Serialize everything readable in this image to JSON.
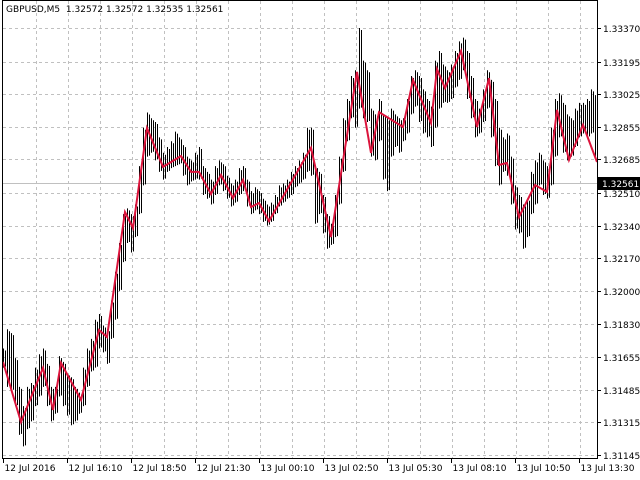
{
  "header": {
    "symbol": "GBPUSD,M5",
    "open": "1.32572",
    "high": "1.32572",
    "low": "1.32535",
    "close": "1.32561"
  },
  "colors": {
    "bars": "#000000",
    "zigzag": "#dc143c",
    "grid": "#c0c0c0",
    "price_line": "#c0c0c0",
    "price_label_bg": "#000000",
    "price_label_text": "#ffffff"
  },
  "chart_data": {
    "type": "bar",
    "title": "GBPUSD,M5",
    "current_price": "1.32561",
    "ylim": [
      1.31145,
      1.3337
    ],
    "y_ticks": [
      "1.33370",
      "1.33195",
      "1.33025",
      "1.32855",
      "1.32685",
      "1.32510",
      "1.32340",
      "1.32170",
      "1.32000",
      "1.31830",
      "1.31655",
      "1.31485",
      "1.31315",
      "1.31145"
    ],
    "x_ticks": [
      {
        "bar": 0,
        "label": "12 Jul 2016"
      },
      {
        "bar": 32,
        "label": "12 Jul 16:10"
      },
      {
        "bar": 64,
        "label": "12 Jul 18:50"
      },
      {
        "bar": 96,
        "label": "12 Jul 21:30"
      },
      {
        "bar": 128,
        "label": "13 Jul 00:10"
      },
      {
        "bar": 160,
        "label": "13 Jul 02:50"
      },
      {
        "bar": 192,
        "label": "13 Jul 05:30"
      },
      {
        "bar": 224,
        "label": "13 Jul 08:10"
      },
      {
        "bar": 256,
        "label": "13 Jul 10:50"
      },
      {
        "bar": 288,
        "label": "13 Jul 13:30"
      }
    ],
    "grid": true,
    "bars_hl": [
      [
        0,
        1.317,
        1.316
      ],
      [
        2,
        1.318,
        1.315
      ],
      [
        4,
        1.3178,
        1.3148
      ],
      [
        6,
        1.3165,
        1.314
      ],
      [
        8,
        1.315,
        1.3125
      ],
      [
        10,
        1.314,
        1.3119
      ],
      [
        12,
        1.315,
        1.3128
      ],
      [
        14,
        1.3152,
        1.3132
      ],
      [
        16,
        1.316,
        1.314
      ],
      [
        18,
        1.3167,
        1.3145
      ],
      [
        20,
        1.317,
        1.315
      ],
      [
        22,
        1.3162,
        1.314
      ],
      [
        24,
        1.315,
        1.3132
      ],
      [
        26,
        1.315,
        1.3136
      ],
      [
        28,
        1.3166,
        1.3145
      ],
      [
        30,
        1.3163,
        1.314
      ],
      [
        32,
        1.3157,
        1.3135
      ],
      [
        34,
        1.3155,
        1.313
      ],
      [
        36,
        1.315,
        1.3132
      ],
      [
        38,
        1.3147,
        1.3136
      ],
      [
        40,
        1.316,
        1.314
      ],
      [
        42,
        1.317,
        1.315
      ],
      [
        44,
        1.3175,
        1.3158
      ],
      [
        46,
        1.3185,
        1.316
      ],
      [
        48,
        1.3188,
        1.317
      ],
      [
        50,
        1.3182,
        1.3168
      ],
      [
        52,
        1.318,
        1.3162
      ],
      [
        54,
        1.3195,
        1.3175
      ],
      [
        56,
        1.321,
        1.3185
      ],
      [
        58,
        1.3225,
        1.32
      ],
      [
        60,
        1.324,
        1.3215
      ],
      [
        62,
        1.3243,
        1.3225
      ],
      [
        64,
        1.324,
        1.322
      ],
      [
        66,
        1.3245,
        1.3228
      ],
      [
        68,
        1.3265,
        1.324
      ],
      [
        70,
        1.3285,
        1.3255
      ],
      [
        72,
        1.3293,
        1.327
      ],
      [
        74,
        1.329,
        1.3272
      ],
      [
        76,
        1.3288,
        1.3268
      ],
      [
        78,
        1.328,
        1.3262
      ],
      [
        80,
        1.3272,
        1.3258
      ],
      [
        82,
        1.3275,
        1.3262
      ],
      [
        84,
        1.3278,
        1.3264
      ],
      [
        86,
        1.3283,
        1.3265
      ],
      [
        88,
        1.328,
        1.3266
      ],
      [
        90,
        1.3276,
        1.326
      ],
      [
        92,
        1.327,
        1.3255
      ],
      [
        94,
        1.3268,
        1.3257
      ],
      [
        96,
        1.3272,
        1.3258
      ],
      [
        98,
        1.3275,
        1.3258
      ],
      [
        100,
        1.3265,
        1.325
      ],
      [
        102,
        1.3262,
        1.3248
      ],
      [
        104,
        1.3258,
        1.3245
      ],
      [
        106,
        1.3265,
        1.325
      ],
      [
        108,
        1.3268,
        1.3255
      ],
      [
        110,
        1.3266,
        1.3252
      ],
      [
        112,
        1.326,
        1.3248
      ],
      [
        114,
        1.3256,
        1.3244
      ],
      [
        116,
        1.3258,
        1.3246
      ],
      [
        118,
        1.3264,
        1.325
      ],
      [
        120,
        1.3265,
        1.3252
      ],
      [
        122,
        1.3258,
        1.3244
      ],
      [
        124,
        1.3252,
        1.324
      ],
      [
        126,
        1.3254,
        1.3242
      ],
      [
        128,
        1.3252,
        1.324
      ],
      [
        130,
        1.3248,
        1.3236
      ],
      [
        132,
        1.3245,
        1.3234
      ],
      [
        134,
        1.3246,
        1.3236
      ],
      [
        136,
        1.325,
        1.324
      ],
      [
        138,
        1.3255,
        1.3244
      ],
      [
        140,
        1.3256,
        1.3246
      ],
      [
        142,
        1.3258,
        1.3248
      ],
      [
        144,
        1.3262,
        1.325
      ],
      [
        146,
        1.3265,
        1.3254
      ],
      [
        148,
        1.3268,
        1.3256
      ],
      [
        150,
        1.3272,
        1.3258
      ],
      [
        152,
        1.3285,
        1.3262
      ],
      [
        154,
        1.3285,
        1.326
      ],
      [
        156,
        1.3265,
        1.3235
      ],
      [
        158,
        1.3262,
        1.324
      ],
      [
        160,
        1.325,
        1.323
      ],
      [
        162,
        1.324,
        1.3222
      ],
      [
        164,
        1.3235,
        1.3224
      ],
      [
        166,
        1.325,
        1.3228
      ],
      [
        168,
        1.327,
        1.3245
      ],
      [
        170,
        1.329,
        1.3262
      ],
      [
        172,
        1.33,
        1.3278
      ],
      [
        174,
        1.3312,
        1.329
      ],
      [
        176,
        1.3315,
        1.3285
      ],
      [
        178,
        1.3337,
        1.3295
      ],
      [
        180,
        1.332,
        1.329
      ],
      [
        182,
        1.3315,
        1.3288
      ],
      [
        184,
        1.3295,
        1.327
      ],
      [
        186,
        1.3292,
        1.3268
      ],
      [
        188,
        1.33,
        1.3278
      ],
      [
        190,
        1.3292,
        1.3258
      ],
      [
        192,
        1.329,
        1.3252
      ],
      [
        194,
        1.3295,
        1.327
      ],
      [
        196,
        1.3292,
        1.3275
      ],
      [
        198,
        1.329,
        1.3272
      ],
      [
        200,
        1.329,
        1.3278
      ],
      [
        202,
        1.33,
        1.3282
      ],
      [
        204,
        1.3312,
        1.3292
      ],
      [
        206,
        1.3315,
        1.3296
      ],
      [
        208,
        1.3312,
        1.3288
      ],
      [
        210,
        1.3305,
        1.3282
      ],
      [
        212,
        1.33,
        1.328
      ],
      [
        214,
        1.3296,
        1.3275
      ],
      [
        216,
        1.332,
        1.3285
      ],
      [
        218,
        1.3325,
        1.3295
      ],
      [
        220,
        1.3318,
        1.3298
      ],
      [
        222,
        1.3315,
        1.3298
      ],
      [
        224,
        1.3318,
        1.33
      ],
      [
        226,
        1.3325,
        1.3306
      ],
      [
        228,
        1.333,
        1.331
      ],
      [
        230,
        1.3332,
        1.3315
      ],
      [
        232,
        1.3325,
        1.33
      ],
      [
        234,
        1.3312,
        1.329
      ],
      [
        236,
        1.33,
        1.328
      ],
      [
        238,
        1.3295,
        1.3282
      ],
      [
        240,
        1.3305,
        1.3288
      ],
      [
        242,
        1.3315,
        1.3295
      ],
      [
        244,
        1.331,
        1.328
      ],
      [
        246,
        1.33,
        1.3265
      ],
      [
        248,
        1.3285,
        1.3255
      ],
      [
        250,
        1.328,
        1.3262
      ],
      [
        252,
        1.3282,
        1.326
      ],
      [
        254,
        1.327,
        1.3245
      ],
      [
        256,
        1.3255,
        1.3232
      ],
      [
        258,
        1.325,
        1.323
      ],
      [
        260,
        1.3245,
        1.3222
      ],
      [
        262,
        1.3248,
        1.3228
      ],
      [
        264,
        1.3262,
        1.324
      ],
      [
        266,
        1.3268,
        1.3245
      ],
      [
        268,
        1.3272,
        1.3255
      ],
      [
        270,
        1.3268,
        1.325
      ],
      [
        272,
        1.3265,
        1.3248
      ],
      [
        274,
        1.3285,
        1.3255
      ],
      [
        276,
        1.33,
        1.327
      ],
      [
        278,
        1.3303,
        1.328
      ],
      [
        280,
        1.3298,
        1.3272
      ],
      [
        282,
        1.3292,
        1.3268
      ],
      [
        284,
        1.329,
        1.327
      ],
      [
        286,
        1.3295,
        1.3275
      ],
      [
        288,
        1.3298,
        1.328
      ],
      [
        290,
        1.3298,
        1.3282
      ],
      [
        292,
        1.33,
        1.328
      ],
      [
        294,
        1.3305,
        1.3282
      ],
      [
        296,
        1.3302,
        1.327
      ]
    ],
    "zigzag": [
      [
        0,
        1.3163
      ],
      [
        9,
        1.31317
      ],
      [
        20,
        1.31599
      ],
      [
        25,
        1.3138
      ],
      [
        29,
        1.31625
      ],
      [
        39,
        1.31432
      ],
      [
        48,
        1.31797
      ],
      [
        52,
        1.3176
      ],
      [
        61,
        1.32411
      ],
      [
        65,
        1.32328
      ],
      [
        72,
        1.32849
      ],
      [
        80,
        1.32646
      ],
      [
        89,
        1.32703
      ],
      [
        94,
        1.3262
      ],
      [
        98,
        1.3262
      ],
      [
        104,
        1.32505
      ],
      [
        109,
        1.32604
      ],
      [
        115,
        1.32484
      ],
      [
        120,
        1.32578
      ],
      [
        124,
        1.32437
      ],
      [
        128,
        1.32458
      ],
      [
        133,
        1.32364
      ],
      [
        154,
        1.32745
      ],
      [
        164,
        1.32281
      ],
      [
        177,
        1.33141
      ],
      [
        184,
        1.32719
      ],
      [
        188,
        1.32932
      ],
      [
        200,
        1.32854
      ],
      [
        205,
        1.33099
      ],
      [
        214,
        1.32875
      ],
      [
        217,
        1.33156
      ],
      [
        221,
        1.33057
      ],
      [
        229,
        1.3325
      ],
      [
        237,
        1.32854
      ],
      [
        243,
        1.33109
      ],
      [
        248,
        1.32656
      ],
      [
        252,
        1.32667
      ],
      [
        258,
        1.32385
      ],
      [
        266,
        1.32552
      ],
      [
        272,
        1.32516
      ],
      [
        277,
        1.32943
      ],
      [
        283,
        1.32682
      ],
      [
        290,
        1.32865
      ],
      [
        297,
        1.32672
      ]
    ]
  }
}
